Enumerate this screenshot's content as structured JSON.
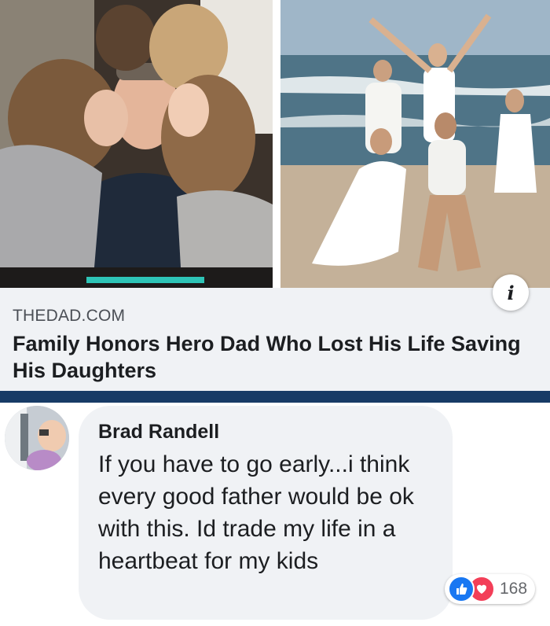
{
  "link_preview": {
    "source": "THEDAD.COM",
    "headline": "Family Honors Hero Dad Who Lost His Life Saving His Daughters",
    "info_icon": "info-icon",
    "images": [
      "family-kissing-dad-photo",
      "family-beach-photo"
    ]
  },
  "colors": {
    "divider": "#173b66",
    "like": "#1877f2",
    "love": "#f33e58",
    "bubble": "#f0f2f5"
  },
  "comment": {
    "author": "Brad Randell",
    "text": "If you have to go early...i think every good father would be ok with this.  Id trade my life in a heartbeat for my kids",
    "reactions": {
      "icons": [
        "thumbs-up-icon",
        "heart-icon"
      ],
      "count": "168"
    }
  }
}
